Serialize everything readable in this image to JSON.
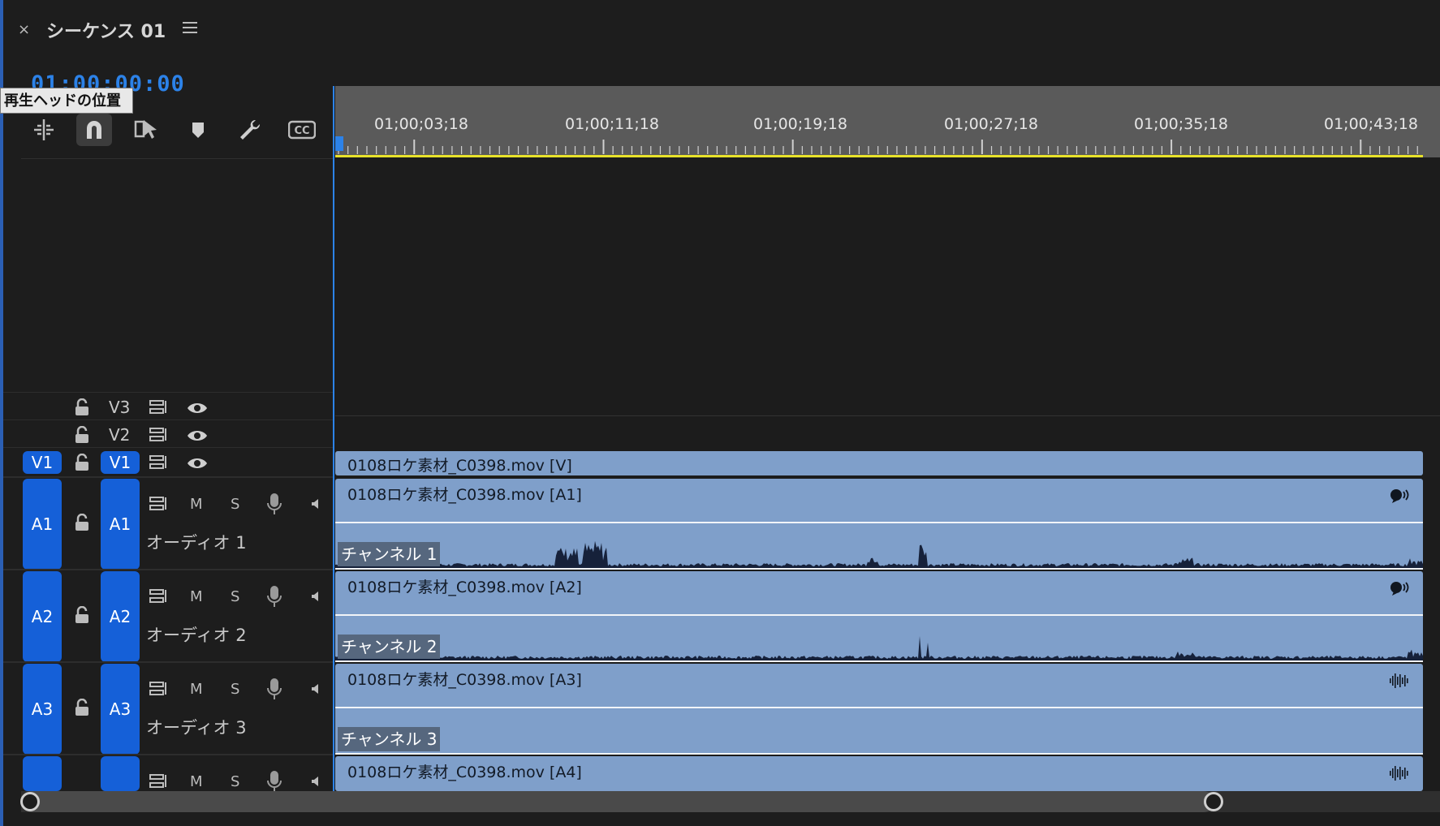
{
  "sequence": {
    "close_label": "×",
    "title": "シーケンス 01",
    "timecode": "01:00:00:00",
    "tooltip": "再生ヘッドの位置"
  },
  "toolbar": [
    {
      "icon": "insert-sequence-icon",
      "name": "tool-nest"
    },
    {
      "icon": "snap-magnet-icon",
      "name": "tool-snap",
      "active": true
    },
    {
      "icon": "linked-selection-icon",
      "name": "tool-linked-selection"
    },
    {
      "icon": "add-marker-icon",
      "name": "tool-add-marker"
    },
    {
      "icon": "wrench-icon",
      "name": "tool-settings"
    },
    {
      "icon": "captions-cc-icon",
      "name": "tool-captions"
    }
  ],
  "ruler": {
    "labels": [
      "01;00;03;18",
      "01;00;11;18",
      "01;00;19;18",
      "01;00;27;18",
      "01;00;35;18",
      "01;00;43;18"
    ]
  },
  "video_tracks": [
    {
      "source": "",
      "target": "V3",
      "clip": ""
    },
    {
      "source": "",
      "target": "V2",
      "clip": ""
    },
    {
      "source": "V1",
      "target": "V1",
      "clip": "0108ロケ素材_C0398.mov [V]"
    }
  ],
  "audio_tracks": [
    {
      "source": "A1",
      "target": "A1",
      "mute": "M",
      "solo": "S",
      "name": "オーディオ 1",
      "clip": "0108ロケ素材_C0398.mov [A1]",
      "channel": "チャンネル 1",
      "clip_icon": "mono-speaker-icon"
    },
    {
      "source": "A2",
      "target": "A2",
      "mute": "M",
      "solo": "S",
      "name": "オーディオ 2",
      "clip": "0108ロケ素材_C0398.mov [A2]",
      "channel": "チャンネル 2",
      "clip_icon": "mono-speaker-icon"
    },
    {
      "source": "A3",
      "target": "A3",
      "mute": "M",
      "solo": "S",
      "name": "オーディオ 3",
      "clip": "0108ロケ素材_C0398.mov [A3]",
      "channel": "チャンネル 3",
      "clip_icon": "waveform-icon"
    },
    {
      "source": "",
      "target": "",
      "mute": "M",
      "solo": "S",
      "name": "",
      "clip": "0108ロケ素材_C0398.mov [A4]",
      "channel": "",
      "clip_icon": "waveform-icon"
    }
  ],
  "colors": {
    "accent": "#1560d8",
    "clip": "#7f9fca",
    "work_area": "#e8e22a",
    "timecode": "#2c82e8"
  }
}
